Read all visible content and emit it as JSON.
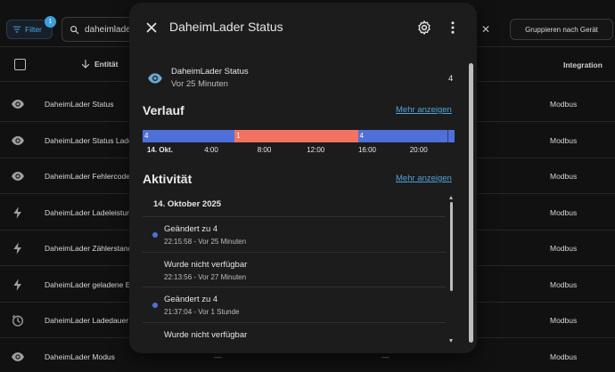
{
  "toolbar": {
    "filter_label": "Filter",
    "filter_badge": "1",
    "search_value": "daheimlade",
    "group_label": "Gruppieren nach Gerät"
  },
  "table": {
    "col_entity": "Entität",
    "col_integration": "Integration",
    "rows": [
      {
        "name": "DaheimLader Status",
        "icon": "eye-icon",
        "integration": "Modbus",
        "dash1": "",
        "dash2": ""
      },
      {
        "name": "DaheimLader Status Lade",
        "icon": "eye-icon",
        "integration": "Modbus",
        "dash1": "",
        "dash2": ""
      },
      {
        "name": "DaheimLader Fehlercode",
        "icon": "eye-icon",
        "integration": "Modbus",
        "dash1": "",
        "dash2": ""
      },
      {
        "name": "DaheimLader Ladeleistun",
        "icon": "flash-icon",
        "integration": "Modbus",
        "dash1": "",
        "dash2": ""
      },
      {
        "name": "DaheimLader Zählerstand",
        "icon": "flash-icon",
        "integration": "Modbus",
        "dash1": "",
        "dash2": ""
      },
      {
        "name": "DaheimLader geladene E",
        "icon": "flash-icon",
        "integration": "Modbus",
        "dash1": "",
        "dash2": ""
      },
      {
        "name": "DaheimLader Ladedauer",
        "icon": "timer-icon",
        "integration": "Modbus",
        "dash1": "",
        "dash2": ""
      },
      {
        "name": "DaheimLader Modus",
        "icon": "eye-icon",
        "integration": "Modbus",
        "dash1": "—",
        "dash2": "—"
      }
    ]
  },
  "dialog": {
    "title": "DaheimLader Status",
    "state": {
      "name": "DaheimLader Status",
      "time": "Vor 25 Minuten",
      "value": "4"
    },
    "history": {
      "title": "Verlauf",
      "more_link": "Mehr anzeigen",
      "segments": [
        {
          "label": "4",
          "start": 0.0,
          "end": 0.295,
          "color": "#4f6fd9"
        },
        {
          "label": "1",
          "start": 0.295,
          "end": 0.69,
          "color": "#f37362"
        },
        {
          "label": "4",
          "start": 0.69,
          "end": 1.0,
          "color": "#4f6fd9"
        }
      ],
      "ticks": [
        {
          "label": "14. Okt.",
          "pos": 0.0
        },
        {
          "label": "4:00",
          "pos": 0.22
        },
        {
          "label": "8:00",
          "pos": 0.39
        },
        {
          "label": "12:00",
          "pos": 0.555
        },
        {
          "label": "16:00",
          "pos": 0.72
        },
        {
          "label": "20:00",
          "pos": 0.885
        }
      ]
    },
    "activity": {
      "title": "Aktivität",
      "more_link": "Mehr anzeigen",
      "date": "14. Oktober 2025",
      "items": [
        {
          "title": "Geändert zu 4",
          "sub": "22:15:58 - Vor 25 Minuten",
          "dot": true
        },
        {
          "title": "Wurde nicht verfügbar",
          "sub": "22:13:56 - Vor 27 Minuten",
          "dot": false
        },
        {
          "title": "Geändert zu 4",
          "sub": "21:37:04 - Vor 1 Stunde",
          "dot": true
        },
        {
          "title": "Wurde nicht verfügbar",
          "sub": "",
          "dot": false
        }
      ]
    }
  },
  "colors": {
    "accent": "#4fa3d9",
    "state_blue": "#4f6fd9",
    "state_red": "#f37362"
  }
}
